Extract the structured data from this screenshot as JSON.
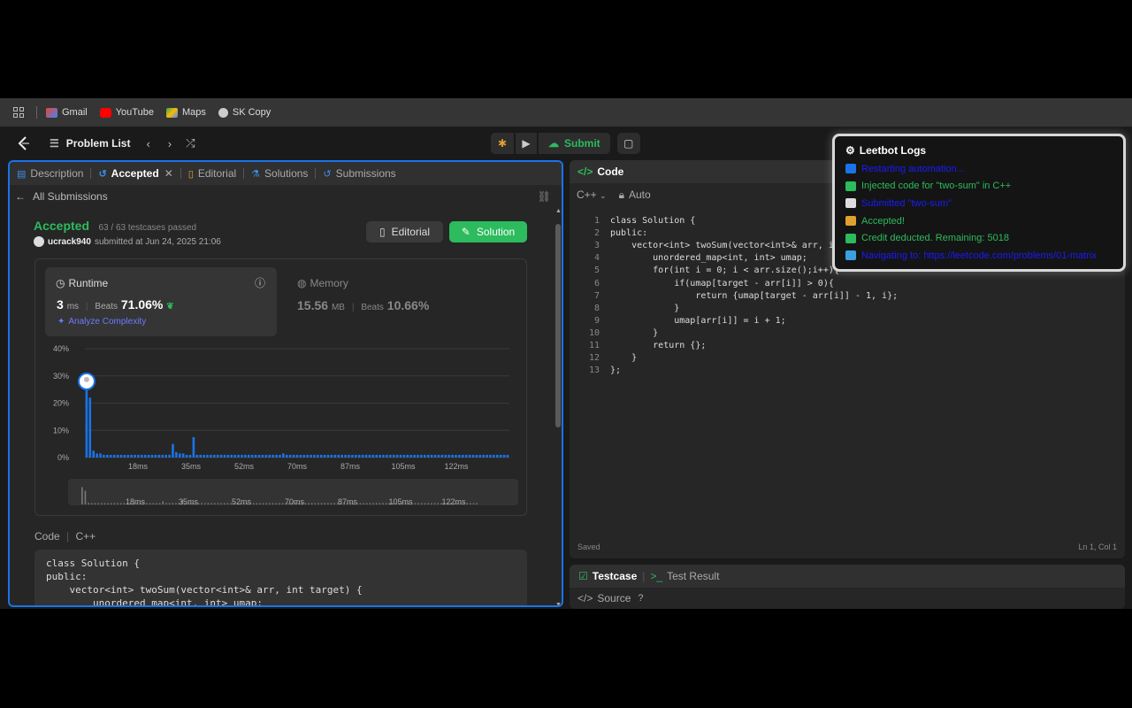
{
  "bookmarks": [
    {
      "label": "Gmail",
      "icon": "gmail-icon",
      "color": "#ea4335"
    },
    {
      "label": "YouTube",
      "icon": "youtube-icon",
      "color": "#ff0000"
    },
    {
      "label": "Maps",
      "icon": "maps-icon",
      "color": "#34a853"
    },
    {
      "label": "SK Copy",
      "icon": "globe-icon",
      "color": "#cccccc"
    }
  ],
  "navbar": {
    "problem_list": "Problem List",
    "submit": "Submit"
  },
  "left_tabs": {
    "description": "Description",
    "accepted": "Accepted",
    "editorial": "Editorial",
    "solutions": "Solutions",
    "submissions": "Submissions"
  },
  "submission": {
    "back": "All Submissions",
    "status": "Accepted",
    "passed": "63 / 63 testcases passed",
    "user": "ucrack940",
    "submitted_at": "submitted at Jun 24, 2025 21:06",
    "editorial_btn": "Editorial",
    "solution_btn": "Solution",
    "runtime_label": "Runtime",
    "runtime_value": "3",
    "runtime_unit": "ms",
    "runtime_beats_label": "Beats",
    "runtime_beats": "71.06%",
    "analyze": "Analyze Complexity",
    "memory_label": "Memory",
    "memory_value": "15.56",
    "memory_unit": "MB",
    "memory_beats_label": "Beats",
    "memory_beats": "10.66%",
    "code_label": "Code",
    "code_lang": "C++"
  },
  "chart_data": {
    "type": "bar",
    "title": "",
    "xlabel": "",
    "ylabel": "",
    "ylim": [
      0,
      40
    ],
    "yticks": [
      "40%",
      "30%",
      "20%",
      "10%",
      "0%"
    ],
    "xticks": [
      "18ms",
      "35ms",
      "52ms",
      "70ms",
      "87ms",
      "105ms",
      "122ms"
    ],
    "values": [
      28,
      22,
      2.5,
      1.5,
      1.5,
      1,
      1,
      1,
      1,
      1,
      1,
      1,
      1,
      1,
      1,
      1,
      1,
      1,
      1,
      1,
      1,
      1,
      1,
      1,
      1,
      5,
      2,
      1.5,
      1.5,
      1,
      1,
      7.5,
      1,
      1,
      1,
      1,
      1,
      1,
      1,
      1,
      1,
      1,
      1,
      1,
      1,
      1,
      1,
      1,
      1,
      1,
      1,
      1,
      1,
      1,
      1,
      1,
      1,
      1.5,
      1,
      1,
      1,
      1,
      1,
      1,
      1,
      1,
      1,
      1,
      1,
      1,
      1,
      1,
      1,
      1,
      1,
      1,
      1,
      1,
      1,
      1,
      1,
      1,
      1,
      1,
      1,
      1,
      1,
      1,
      1,
      1,
      1,
      1,
      1,
      1,
      1,
      1,
      1,
      1,
      1,
      1,
      1,
      1,
      1,
      1,
      1,
      1,
      1,
      1,
      1,
      1,
      1,
      1,
      1,
      1,
      1,
      1,
      1,
      1,
      1,
      1,
      1,
      1,
      1
    ],
    "highlight_index": 0,
    "bar_color": "#1a73e8",
    "grid": true
  },
  "left_code_lines": [
    "class Solution {",
    "public:",
    "    vector<int> twoSum(vector<int>& arr, int target) {",
    "        unordered_map<int, int> umap;"
  ],
  "editor": {
    "tab": "Code",
    "lang": "C++",
    "mode": "Auto",
    "line_numbers": [
      "1",
      "2",
      "3",
      "4",
      "5",
      "6",
      "7",
      "8",
      "9",
      "10",
      "11",
      "12",
      "13"
    ],
    "lines": [
      "class Solution {",
      "public:",
      "    vector<int> twoSum(vector<int>& arr, int target) {",
      "        unordered_map<int, int> umap;",
      "        for(int i = 0; i < arr.size();i++){",
      "            if(umap[target - arr[i]] > 0){",
      "                return {umap[target - arr[i]] - 1, i};",
      "            }",
      "            umap[arr[i]] = i + 1;",
      "        }",
      "        return {};",
      "    }",
      "};"
    ],
    "saved": "Saved",
    "cursor": "Ln 1, Col 1"
  },
  "bottom": {
    "testcase": "Testcase",
    "test_result": "Test Result",
    "source": "Source"
  },
  "logs": {
    "title": "Leetbot Logs",
    "entries": [
      {
        "text": "Restarting automation...",
        "color": "#1a1aff",
        "icon_color": "#1a73e8"
      },
      {
        "text": "Injected code for \"two-sum\" in C++",
        "color": "#2cbb5d",
        "icon_color": "#2cbb5d"
      },
      {
        "text": "Submitted \"two-sum\"",
        "color": "#1a1aff",
        "icon_color": "#dddddd"
      },
      {
        "text": "Accepted!",
        "color": "#2cbb5d",
        "icon_color": "#e0a030"
      },
      {
        "text": "Credit deducted. Remaining: 5018",
        "color": "#2cbb5d",
        "icon_color": "#2cbb5d"
      },
      {
        "text": "Navigating to: https://leetcode.com/problems/01-matrix",
        "color": "#1a1aff",
        "icon_color": "#3aa0e0"
      }
    ]
  }
}
